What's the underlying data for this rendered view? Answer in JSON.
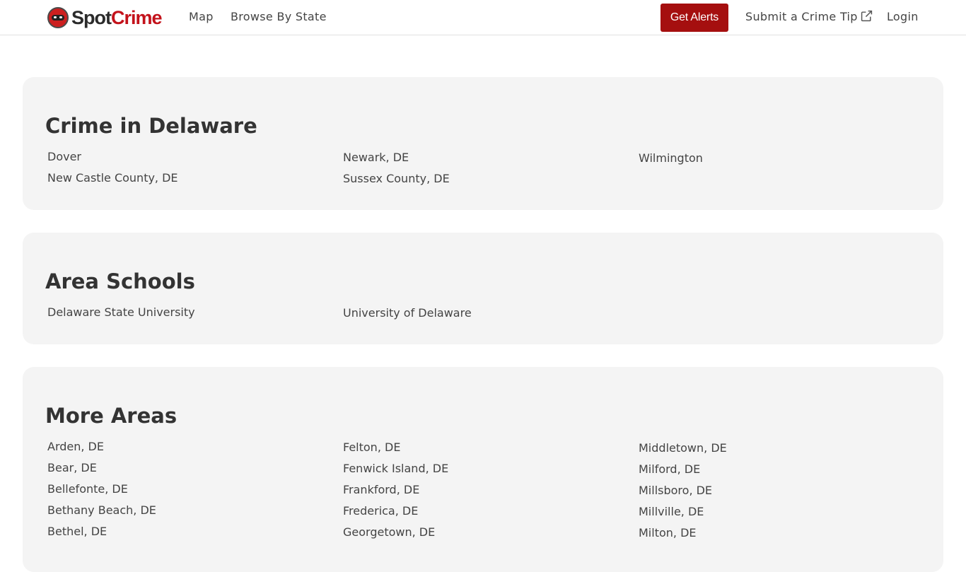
{
  "header": {
    "logo": {
      "spot": "Spot",
      "crime": "Crime"
    },
    "nav": {
      "map": "Map",
      "browse": "Browse By State"
    },
    "alerts_button": "Get Alerts",
    "tip_link": "Submit a Crime Tip",
    "login": "Login"
  },
  "sections": {
    "crime": {
      "title": "Crime in Delaware",
      "items": [
        "Dover",
        "New Castle County, DE",
        "Newark, DE",
        "Sussex County, DE",
        "Wilmington"
      ]
    },
    "schools": {
      "title": "Area Schools",
      "items": [
        "Delaware State University",
        "University of Delaware"
      ]
    },
    "more": {
      "title": "More Areas",
      "items": [
        "Arden, DE",
        "Bear, DE",
        "Bellefonte, DE",
        "Bethany Beach, DE",
        "Bethel, DE",
        "Felton, DE",
        "Fenwick Island, DE",
        "Frankford, DE",
        "Frederica, DE",
        "Georgetown, DE",
        "Middletown, DE",
        "Milford, DE",
        "Millsboro, DE",
        "Millville, DE",
        "Milton, DE"
      ]
    }
  },
  "colors": {
    "brand_red": "#a50f0f",
    "logo_red": "#c3121b",
    "card_bg": "#f4f4f4"
  },
  "icons": {
    "logo": "spotcrime-logo-icon",
    "external": "external-link-icon"
  }
}
